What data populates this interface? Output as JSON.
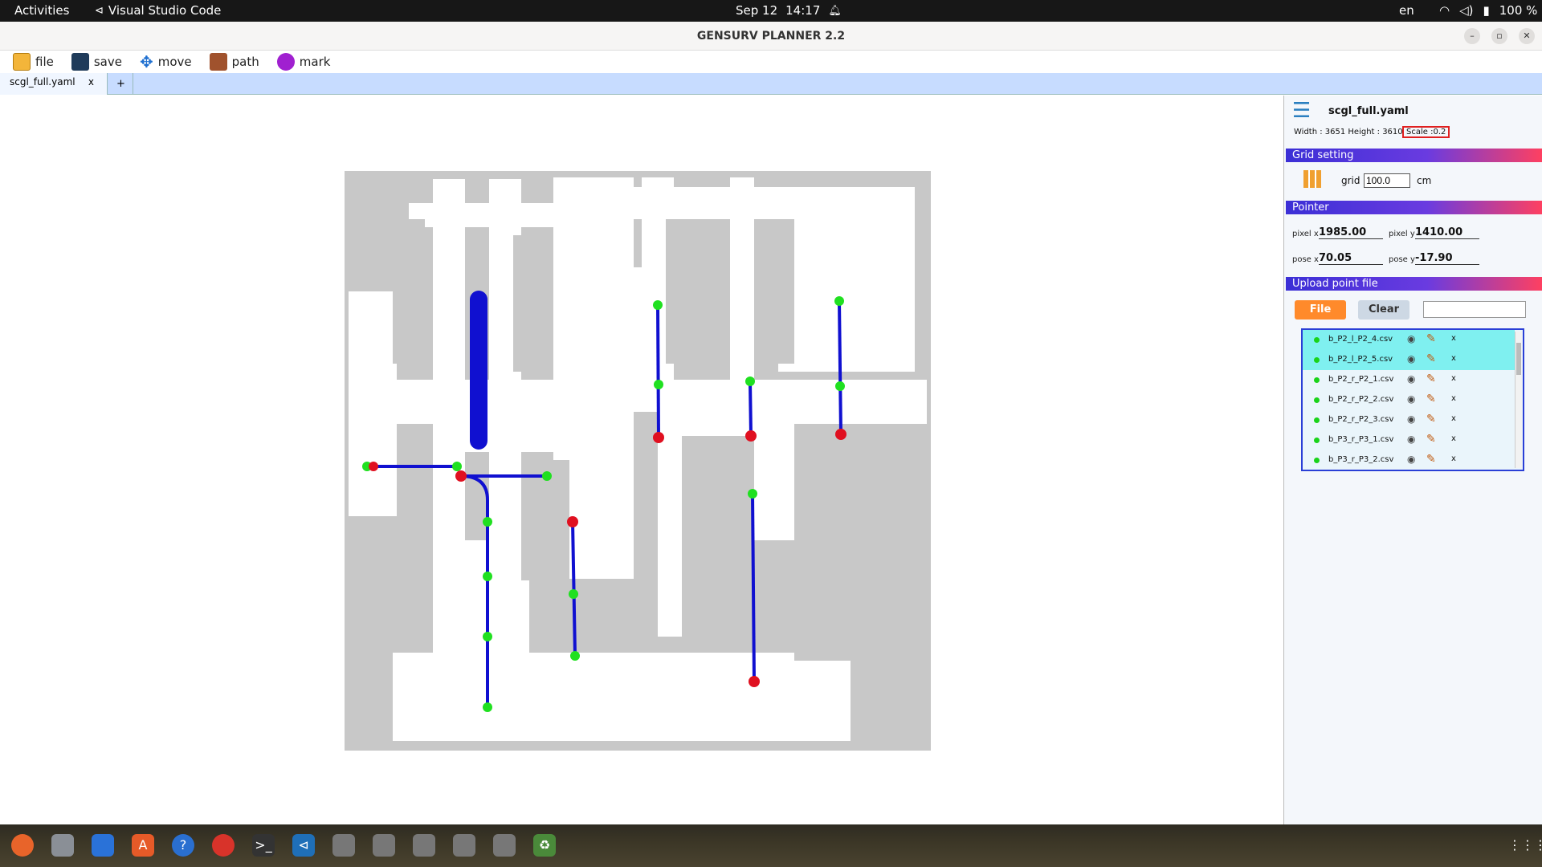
{
  "topbar": {
    "activities": "Activities",
    "app_name": "Visual Studio Code",
    "date": "Sep 12",
    "time": "14:17",
    "lang": "en",
    "battery": "100 %"
  },
  "window": {
    "title": "GENSURV PLANNER 2.2"
  },
  "toolbar": {
    "file": "file",
    "save": "save",
    "move": "move",
    "path": "path",
    "mark": "mark"
  },
  "tabs": {
    "active": "scgl_full.yaml",
    "close": "x",
    "add": "+"
  },
  "side": {
    "filename": "scgl_full.yaml",
    "dims": "Width : 3651 Height : 3610",
    "scale": "Scale :0.2",
    "grid_setting": "Grid setting",
    "grid_label": "grid",
    "grid_value": "100.0",
    "grid_unit": "cm",
    "pointer": "Pointer",
    "pixel_x_label": "pixel x",
    "pixel_x": "1985.00",
    "pixel_y_label": "pixel y",
    "pixel_y": "1410.00",
    "pose_x_label": "pose x",
    "pose_x": "70.05",
    "pose_y_label": "pose y",
    "pose_y": "-17.90",
    "upload": "Upload point file",
    "file_btn": "File",
    "clear_btn": "Clear",
    "files": [
      {
        "name": "b_P2_l_P2_4.csv",
        "selected": true
      },
      {
        "name": "b_P2_l_P2_5.csv",
        "selected": true
      },
      {
        "name": "b_P2_r_P2_1.csv",
        "selected": false
      },
      {
        "name": "b_P2_r_P2_2.csv",
        "selected": false
      },
      {
        "name": "b_P2_r_P2_3.csv",
        "selected": false
      },
      {
        "name": "b_P3_r_P3_1.csv",
        "selected": false
      },
      {
        "name": "b_P3_r_P3_2.csv",
        "selected": false
      }
    ],
    "delete_label": "x"
  },
  "colors": {
    "path": "#1010d0",
    "start_point": "#e01020",
    "waypoint": "#20e020",
    "accent": "#ff8a2b"
  }
}
